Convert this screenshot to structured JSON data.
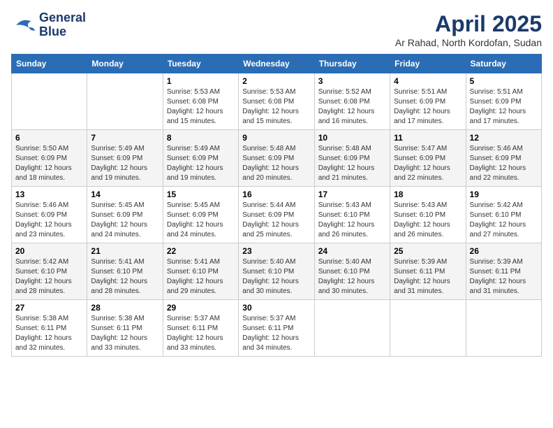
{
  "header": {
    "logo_line1": "General",
    "logo_line2": "Blue",
    "title": "April 2025",
    "subtitle": "Ar Rahad, North Kordofan, Sudan"
  },
  "weekdays": [
    "Sunday",
    "Monday",
    "Tuesday",
    "Wednesday",
    "Thursday",
    "Friday",
    "Saturday"
  ],
  "weeks": [
    [
      {
        "day": "",
        "sunrise": "",
        "sunset": "",
        "daylight": ""
      },
      {
        "day": "",
        "sunrise": "",
        "sunset": "",
        "daylight": ""
      },
      {
        "day": "1",
        "sunrise": "Sunrise: 5:53 AM",
        "sunset": "Sunset: 6:08 PM",
        "daylight": "Daylight: 12 hours and 15 minutes."
      },
      {
        "day": "2",
        "sunrise": "Sunrise: 5:53 AM",
        "sunset": "Sunset: 6:08 PM",
        "daylight": "Daylight: 12 hours and 15 minutes."
      },
      {
        "day": "3",
        "sunrise": "Sunrise: 5:52 AM",
        "sunset": "Sunset: 6:08 PM",
        "daylight": "Daylight: 12 hours and 16 minutes."
      },
      {
        "day": "4",
        "sunrise": "Sunrise: 5:51 AM",
        "sunset": "Sunset: 6:09 PM",
        "daylight": "Daylight: 12 hours and 17 minutes."
      },
      {
        "day": "5",
        "sunrise": "Sunrise: 5:51 AM",
        "sunset": "Sunset: 6:09 PM",
        "daylight": "Daylight: 12 hours and 17 minutes."
      }
    ],
    [
      {
        "day": "6",
        "sunrise": "Sunrise: 5:50 AM",
        "sunset": "Sunset: 6:09 PM",
        "daylight": "Daylight: 12 hours and 18 minutes."
      },
      {
        "day": "7",
        "sunrise": "Sunrise: 5:49 AM",
        "sunset": "Sunset: 6:09 PM",
        "daylight": "Daylight: 12 hours and 19 minutes."
      },
      {
        "day": "8",
        "sunrise": "Sunrise: 5:49 AM",
        "sunset": "Sunset: 6:09 PM",
        "daylight": "Daylight: 12 hours and 19 minutes."
      },
      {
        "day": "9",
        "sunrise": "Sunrise: 5:48 AM",
        "sunset": "Sunset: 6:09 PM",
        "daylight": "Daylight: 12 hours and 20 minutes."
      },
      {
        "day": "10",
        "sunrise": "Sunrise: 5:48 AM",
        "sunset": "Sunset: 6:09 PM",
        "daylight": "Daylight: 12 hours and 21 minutes."
      },
      {
        "day": "11",
        "sunrise": "Sunrise: 5:47 AM",
        "sunset": "Sunset: 6:09 PM",
        "daylight": "Daylight: 12 hours and 22 minutes."
      },
      {
        "day": "12",
        "sunrise": "Sunrise: 5:46 AM",
        "sunset": "Sunset: 6:09 PM",
        "daylight": "Daylight: 12 hours and 22 minutes."
      }
    ],
    [
      {
        "day": "13",
        "sunrise": "Sunrise: 5:46 AM",
        "sunset": "Sunset: 6:09 PM",
        "daylight": "Daylight: 12 hours and 23 minutes."
      },
      {
        "day": "14",
        "sunrise": "Sunrise: 5:45 AM",
        "sunset": "Sunset: 6:09 PM",
        "daylight": "Daylight: 12 hours and 24 minutes."
      },
      {
        "day": "15",
        "sunrise": "Sunrise: 5:45 AM",
        "sunset": "Sunset: 6:09 PM",
        "daylight": "Daylight: 12 hours and 24 minutes."
      },
      {
        "day": "16",
        "sunrise": "Sunrise: 5:44 AM",
        "sunset": "Sunset: 6:09 PM",
        "daylight": "Daylight: 12 hours and 25 minutes."
      },
      {
        "day": "17",
        "sunrise": "Sunrise: 5:43 AM",
        "sunset": "Sunset: 6:10 PM",
        "daylight": "Daylight: 12 hours and 26 minutes."
      },
      {
        "day": "18",
        "sunrise": "Sunrise: 5:43 AM",
        "sunset": "Sunset: 6:10 PM",
        "daylight": "Daylight: 12 hours and 26 minutes."
      },
      {
        "day": "19",
        "sunrise": "Sunrise: 5:42 AM",
        "sunset": "Sunset: 6:10 PM",
        "daylight": "Daylight: 12 hours and 27 minutes."
      }
    ],
    [
      {
        "day": "20",
        "sunrise": "Sunrise: 5:42 AM",
        "sunset": "Sunset: 6:10 PM",
        "daylight": "Daylight: 12 hours and 28 minutes."
      },
      {
        "day": "21",
        "sunrise": "Sunrise: 5:41 AM",
        "sunset": "Sunset: 6:10 PM",
        "daylight": "Daylight: 12 hours and 28 minutes."
      },
      {
        "day": "22",
        "sunrise": "Sunrise: 5:41 AM",
        "sunset": "Sunset: 6:10 PM",
        "daylight": "Daylight: 12 hours and 29 minutes."
      },
      {
        "day": "23",
        "sunrise": "Sunrise: 5:40 AM",
        "sunset": "Sunset: 6:10 PM",
        "daylight": "Daylight: 12 hours and 30 minutes."
      },
      {
        "day": "24",
        "sunrise": "Sunrise: 5:40 AM",
        "sunset": "Sunset: 6:10 PM",
        "daylight": "Daylight: 12 hours and 30 minutes."
      },
      {
        "day": "25",
        "sunrise": "Sunrise: 5:39 AM",
        "sunset": "Sunset: 6:11 PM",
        "daylight": "Daylight: 12 hours and 31 minutes."
      },
      {
        "day": "26",
        "sunrise": "Sunrise: 5:39 AM",
        "sunset": "Sunset: 6:11 PM",
        "daylight": "Daylight: 12 hours and 31 minutes."
      }
    ],
    [
      {
        "day": "27",
        "sunrise": "Sunrise: 5:38 AM",
        "sunset": "Sunset: 6:11 PM",
        "daylight": "Daylight: 12 hours and 32 minutes."
      },
      {
        "day": "28",
        "sunrise": "Sunrise: 5:38 AM",
        "sunset": "Sunset: 6:11 PM",
        "daylight": "Daylight: 12 hours and 33 minutes."
      },
      {
        "day": "29",
        "sunrise": "Sunrise: 5:37 AM",
        "sunset": "Sunset: 6:11 PM",
        "daylight": "Daylight: 12 hours and 33 minutes."
      },
      {
        "day": "30",
        "sunrise": "Sunrise: 5:37 AM",
        "sunset": "Sunset: 6:11 PM",
        "daylight": "Daylight: 12 hours and 34 minutes."
      },
      {
        "day": "",
        "sunrise": "",
        "sunset": "",
        "daylight": ""
      },
      {
        "day": "",
        "sunrise": "",
        "sunset": "",
        "daylight": ""
      },
      {
        "day": "",
        "sunrise": "",
        "sunset": "",
        "daylight": ""
      }
    ]
  ]
}
